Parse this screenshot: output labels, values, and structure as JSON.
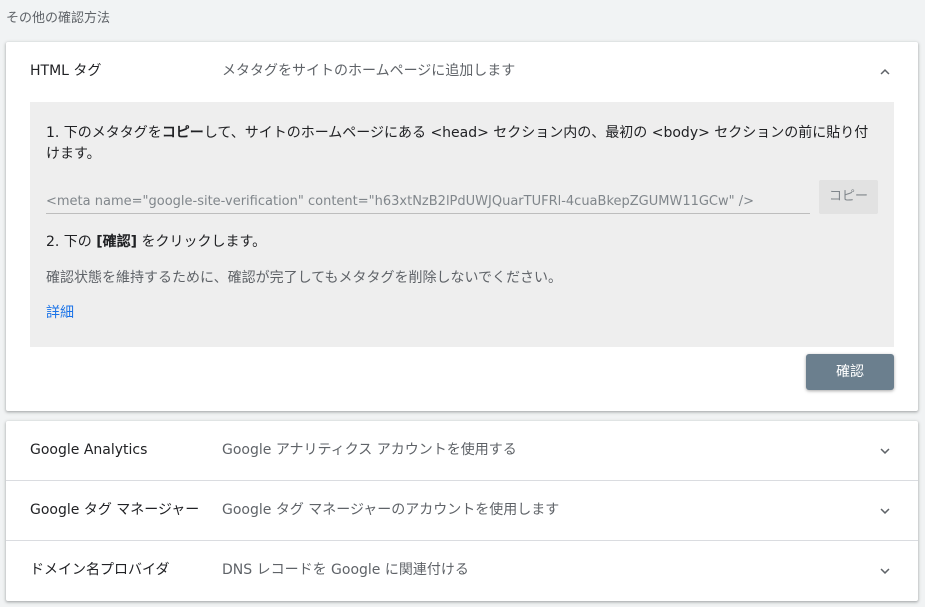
{
  "page": {
    "section_title": "その他の確認方法"
  },
  "html_tag": {
    "name": "HTML タグ",
    "description": "メタタグをサイトのホームページに追加します",
    "expanded": true,
    "step1_part1": "1. 下のメタタグを",
    "step1_bold": "コピー",
    "step1_part2": "して、サイトのホームページにある <head> セクション内の、最初の <body> セクションの前に貼り付けます。",
    "meta_tag_value": "<meta name=\"google-site-verification\" content=\"h63xtNzB2lPdUWJQuarTUFRl-4cuaBkepZGUMW11GCw\" />",
    "copy_label": "コピー",
    "step2_part1": "2. 下の ",
    "step2_bold": "[確認]",
    "step2_part2": " をクリックします。",
    "note": "確認状態を維持するために、確認が完了してもメタタグを削除しないでください。",
    "details_link": "詳細",
    "verify_label": "確認"
  },
  "methods": [
    {
      "name": "Google Analytics",
      "description": "Google アナリティクス アカウントを使用する",
      "expanded": false
    },
    {
      "name": "Google タグ マネージャー",
      "description": "Google タグ マネージャーのアカウントを使用します",
      "expanded": false
    },
    {
      "name": "ドメイン名プロバイダ",
      "description": "DNS レコードを Google に関連付ける",
      "expanded": false
    }
  ],
  "icons": {
    "expand_less": "chevron-up-icon",
    "expand_more": "chevron-down-icon"
  },
  "colors": {
    "link": "#1a73e8",
    "verify_button": "#6b7f8e",
    "content_background": "#eeeeee",
    "page_background": "#f1f3f4"
  }
}
